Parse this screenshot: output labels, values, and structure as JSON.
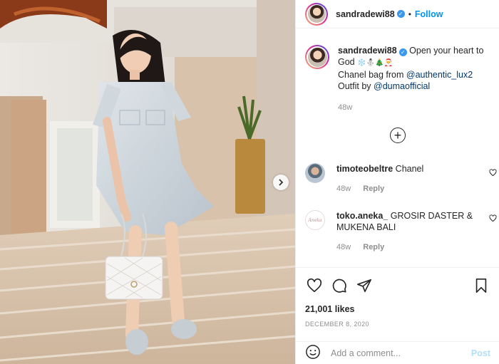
{
  "post": {
    "username": "sandradewi88",
    "dot": "•",
    "follow_label": "Follow",
    "caption": {
      "text_main": "Open your heart to God",
      "emojis": "❄️⛄🎄🎅",
      "line2_prefix": "Chanel bag from ",
      "line2_mention": "@authentic_lux2",
      "line3_prefix": "Outfit by ",
      "line3_mention": "@dumaofficial",
      "time": "48w"
    },
    "load_more_icon": "plus-circle-icon",
    "comments": [
      {
        "username": "timoteobeltre",
        "text": "Chanel",
        "time": "48w",
        "reply_label": "Reply"
      },
      {
        "username": "toko.aneka_",
        "text": "GROSIR DASTER & MUKENA BALI",
        "time": "48w",
        "reply_label": "Reply",
        "avatar_text": "Aneka"
      }
    ],
    "likes": "21,001 likes",
    "date": "DECEMBER 8, 2020",
    "add_comment_placeholder": "Add a comment...",
    "post_label": "Post",
    "icons": [
      "heart-icon",
      "comment-icon",
      "share-icon",
      "bookmark-icon",
      "emoji-icon",
      "chevron-right-icon"
    ],
    "colors": {
      "link": "#0095f6",
      "mention": "#00376b",
      "muted": "#8e8e8e",
      "post_disabled": "#b2dffc"
    }
  }
}
